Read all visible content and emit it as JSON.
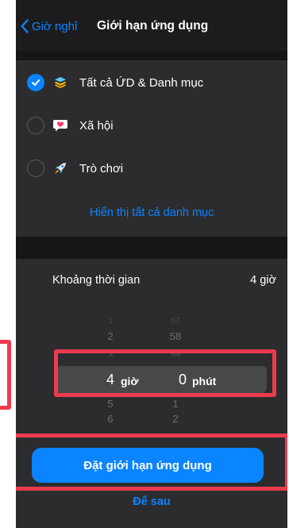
{
  "nav": {
    "back_label": "Giờ nghỉ",
    "title": "Giới hạn ứng dụng"
  },
  "categories": [
    {
      "label": "Tất cả ỨD & Danh mục",
      "selected": true,
      "icon": "stack-layers-icon"
    },
    {
      "label": "Xã hội",
      "selected": false,
      "icon": "chat-heart-icon"
    },
    {
      "label": "Trò chơi",
      "selected": false,
      "icon": "rocket-icon"
    }
  ],
  "show_all_label": "Hiển thị tất cả danh mục",
  "duration": {
    "label": "Khoảng thời gian",
    "value": "4 giờ"
  },
  "picker": {
    "hours_above": [
      "1",
      "2",
      "3"
    ],
    "hours_selected": "4",
    "hours_unit": "giờ",
    "hours_below": [
      "5",
      "6"
    ],
    "minutes_above": [
      "57",
      "58",
      "59"
    ],
    "minutes_selected": "0",
    "minutes_unit": "phút",
    "minutes_below": [
      "1",
      "2"
    ]
  },
  "primary_button_label": "Đặt giới hạn ứng dụng",
  "later_button_label": "Để sau",
  "colors": {
    "accent": "#0a84ff",
    "highlight": "#ee3a4e",
    "background": "#1c1c1e",
    "cell": "#2c2c2e"
  }
}
